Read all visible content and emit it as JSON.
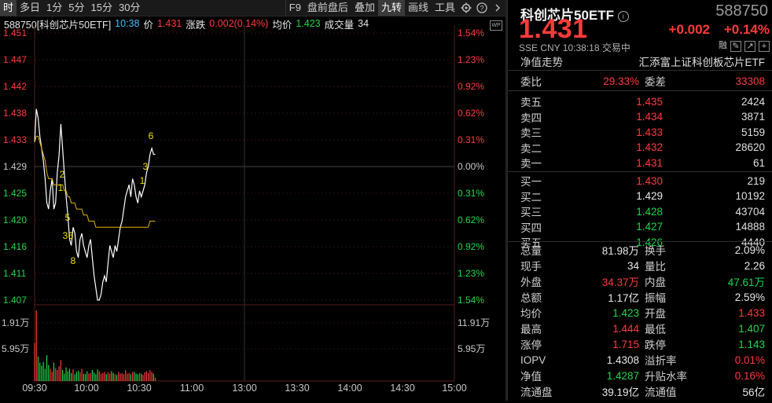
{
  "toolbar": {
    "left": [
      "时",
      "多日",
      "1分",
      "5分",
      "15分",
      "30分"
    ],
    "right": [
      "F9",
      "盘前盘后",
      "叠加",
      "九转",
      "画线",
      "工具"
    ],
    "active_left": "时",
    "active_right": "九转",
    "icons": [
      "gear-icon",
      "help-icon",
      "chevron-right-icon"
    ]
  },
  "infobar": {
    "name": "588750[科创芯片50ETF]",
    "time": "10:38",
    "price_label": "价",
    "price": "1.431",
    "change_label": "涨跌",
    "change": "0.002(0.14%)",
    "avg_label": "均价",
    "avg": "1.423",
    "vol_label": "成交量",
    "vol": "34"
  },
  "chart": {
    "left_ticks": [
      "1.451",
      "1.447",
      "1.442",
      "1.438",
      "1.433",
      "1.429",
      "1.425",
      "1.420",
      "1.416",
      "1.411",
      "1.407"
    ],
    "right_ticks": [
      "1.54%",
      "1.23%",
      "0.92%",
      "0.62%",
      "0.31%",
      "0.00%",
      "0.31%",
      "0.62%",
      "0.92%",
      "1.23%",
      "1.54%"
    ],
    "vol_left": [
      "1.91万",
      "5.95万"
    ],
    "vol_right": [
      "11.91万",
      "5.95万"
    ],
    "time_ticks": [
      "09:30",
      "10:00",
      "10:30",
      "11:00",
      "13:00",
      "13:30",
      "14:00",
      "14:30",
      "15:00"
    ],
    "td_labels": [
      "6",
      "3",
      "1",
      "2",
      "1",
      "5",
      "3",
      "6",
      "8"
    ],
    "wp_badge": "WP",
    "colors": {
      "up": "#ff3b3b",
      "down": "#1fd74a",
      "price": "#ffffff",
      "avg": "#e0b000",
      "grid": "#5a1a1a"
    }
  },
  "quote": {
    "title": "科创芯片50ETF",
    "code": "588750",
    "price": "1.431",
    "change": "+0.002",
    "change_pct": "+0.14%",
    "meta": "SSE  CNY  10:38:18  交易中",
    "nav_label": "净值走势",
    "fund_name": "汇添富上证科创板芯片ETF",
    "icons": [
      "margin-badge-icon",
      "edit-icon",
      "share-icon",
      "add-icon"
    ],
    "margin_badge": "融",
    "weibi_label": "委比",
    "weibi": "29.33%",
    "weicha_label": "委差",
    "weicha": "33308"
  },
  "asks": [
    {
      "label": "卖五",
      "price": "1.435",
      "vol": "2424",
      "color": "red"
    },
    {
      "label": "卖四",
      "price": "1.434",
      "vol": "3871",
      "color": "red"
    },
    {
      "label": "卖三",
      "price": "1.433",
      "vol": "5159",
      "color": "red"
    },
    {
      "label": "卖二",
      "price": "1.432",
      "vol": "28620",
      "color": "red"
    },
    {
      "label": "卖一",
      "price": "1.431",
      "vol": "61",
      "color": "red"
    }
  ],
  "bids": [
    {
      "label": "买一",
      "price": "1.430",
      "vol": "219",
      "color": "red"
    },
    {
      "label": "买二",
      "price": "1.429",
      "vol": "10192",
      "color": "white"
    },
    {
      "label": "买三",
      "price": "1.428",
      "vol": "43704",
      "color": "green"
    },
    {
      "label": "买四",
      "price": "1.427",
      "vol": "14888",
      "color": "green"
    },
    {
      "label": "买五",
      "price": "1.426",
      "vol": "4440",
      "color": "green"
    }
  ],
  "stats": [
    {
      "l1": "总量",
      "v1": "81.98万",
      "c1": "white",
      "l2": "换手",
      "v2": "2.09%",
      "c2": "white"
    },
    {
      "l1": "现手",
      "v1": "34",
      "c1": "white",
      "l2": "量比",
      "v2": "2.26",
      "c2": "white"
    },
    {
      "l1": "外盘",
      "v1": "34.37万",
      "c1": "red",
      "l2": "内盘",
      "v2": "47.61万",
      "c2": "green"
    },
    {
      "l1": "总额",
      "v1": "1.17亿",
      "c1": "white",
      "l2": "振幅",
      "v2": "2.59%",
      "c2": "white"
    },
    {
      "l1": "均价",
      "v1": "1.423",
      "c1": "green",
      "l2": "开盘",
      "v2": "1.433",
      "c2": "red"
    },
    {
      "l1": "最高",
      "v1": "1.444",
      "c1": "red",
      "l2": "最低",
      "v2": "1.407",
      "c2": "green"
    },
    {
      "l1": "涨停",
      "v1": "1.715",
      "c1": "red",
      "l2": "跌停",
      "v2": "1.143",
      "c2": "green"
    },
    {
      "l1": "IOPV",
      "v1": "1.4308",
      "c1": "white",
      "l2": "溢折率",
      "v2": "0.01%",
      "c2": "red"
    },
    {
      "l1": "净值",
      "v1": "1.4287",
      "c1": "green",
      "l2": "升贴水率",
      "v2": "0.16%",
      "c2": "red"
    },
    {
      "l1": "流通盘",
      "v1": "39.19亿",
      "c1": "white",
      "l2": "流通值",
      "v2": "56亿",
      "c2": "white"
    }
  ]
}
